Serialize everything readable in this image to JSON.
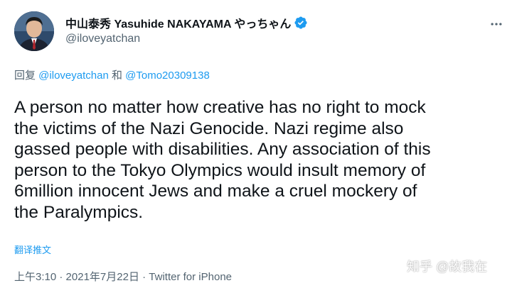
{
  "author": {
    "display_name": "中山泰秀 Yasuhide NAKAYAMA やっちゃん",
    "handle": "@iloveyatchan",
    "verified": true
  },
  "reply_context": {
    "prefix": "回复 ",
    "mention_1": "@iloveyatchan",
    "conjunction": " 和 ",
    "mention_2": "@Tomo20309138"
  },
  "tweet": {
    "text_lines": [
      "A person no matter how creative has no right to mock",
      "the victims of the Nazi Genocide. Nazi regime also",
      "gassed people with disabilities. Any association of this",
      "person to the Tokyo Olympics would insult memory of",
      "6million innocent Jews and make a cruel mockery of",
      "the Paralympics."
    ],
    "translate_label": "翻译推文"
  },
  "meta": {
    "time": "上午3:10",
    "separator": " · ",
    "date": "2021年7月22日",
    "source": "Twitter for iPhone"
  },
  "watermark": "知乎 @故我在",
  "icons": {
    "verified": "verified-badge-icon",
    "more": "more-options-icon"
  },
  "colors": {
    "text": "#0f1419",
    "secondary": "#536471",
    "link": "#1d9bf0"
  }
}
